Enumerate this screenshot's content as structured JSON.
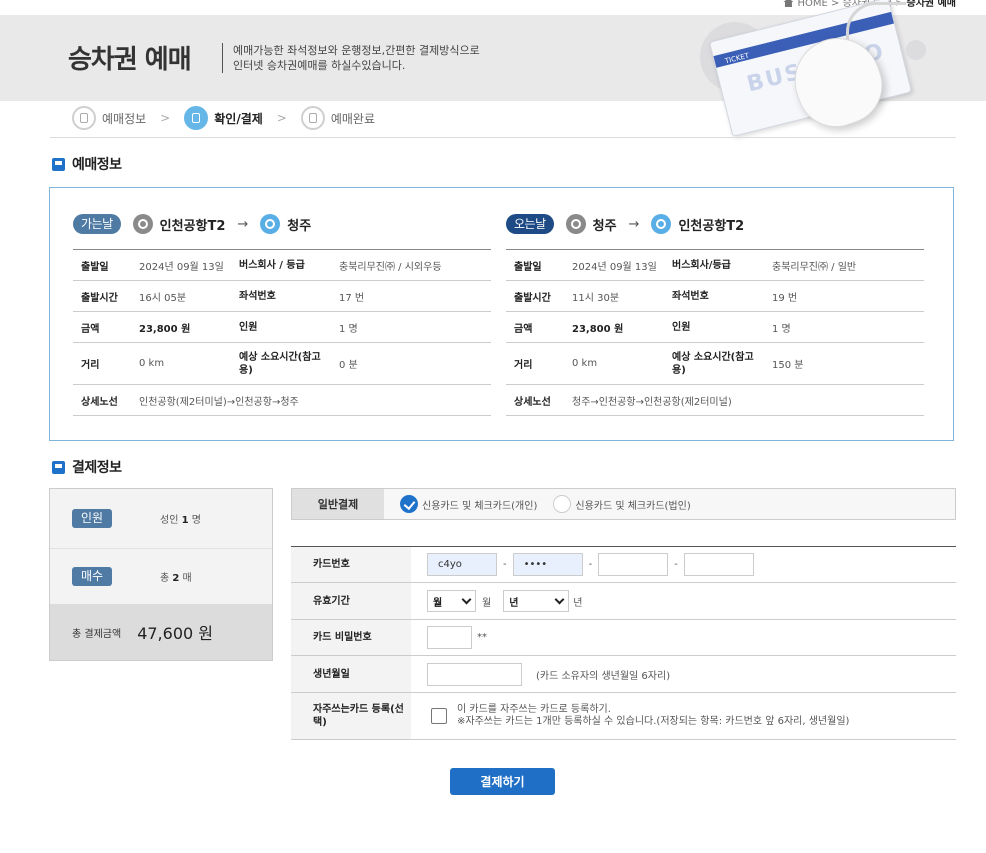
{
  "breadcrumb": {
    "home": "HOME",
    "sep": ">",
    "parent": "승차권 예매",
    "current": "승차권 예매"
  },
  "hero": {
    "title": "승차권 예매",
    "desc_line1": "예매가능한 좌석정보와 운행정보,간편한 결제방식으로",
    "desc_line2": "인터넷 승차권예매를 하실수있습니다.",
    "card_stripe": "TICKET",
    "card_logo": "BUS TAGO"
  },
  "steps": [
    {
      "label": "예매정보",
      "active": false
    },
    {
      "label": "확인/결제",
      "active": true
    },
    {
      "label": "예매완료",
      "active": false
    }
  ],
  "step_arrow": ">",
  "reservation": {
    "title": "예매정보",
    "outbound": {
      "badge": "가는날",
      "from": "인천공항T2",
      "to": "청주",
      "arrow": "→",
      "labels": {
        "date": "출발일",
        "company": "버스회사 / 등급",
        "time": "출발시간",
        "seat": "좌석번호",
        "price": "금액",
        "people": "인원",
        "distance": "거리",
        "duration": "예상 소요시간(참고용)",
        "route": "상세노선"
      },
      "date": "2024년 09월 13일",
      "company": "충북리무진㈜ / 시외우등",
      "time": "16시 05분",
      "seat": "17 번",
      "price": "23,800 원",
      "people": "1 명",
      "distance": "0 km",
      "duration": "0 분",
      "route": "인천공항(제2터미널)→인천공항→청주"
    },
    "return": {
      "badge": "오는날",
      "from": "청주",
      "to": "인천공항T2",
      "arrow": "→",
      "labels": {
        "date": "출발일",
        "company": "버스회사/등급",
        "time": "출발시간",
        "seat": "좌석번호",
        "price": "금액",
        "people": "인원",
        "distance": "거리",
        "duration": "예상 소요시간(참고용)",
        "route": "상세노선"
      },
      "date": "2024년 09월 13일",
      "company": "충북리무진㈜ / 일반",
      "time": "11시 30분",
      "seat": "19 번",
      "price": "23,800 원",
      "people": "1 명",
      "distance": "0 km",
      "duration": "150 분",
      "route": "청주→인천공항→인천공항(제2터미널)"
    }
  },
  "payment": {
    "title": "결제정보",
    "summary": {
      "people_badge": "인원",
      "people_value_pre": "성인",
      "people_value_num": "1",
      "people_value_post": "명",
      "count_badge": "매수",
      "count_value_pre": "총",
      "count_value_num": "2",
      "count_value_post": "매",
      "total_label": "총 결제금액",
      "total_value": "47,600 원"
    },
    "type_tab": "일반결제",
    "options": [
      {
        "label": "신용카드 및 체크카드(개인)",
        "selected": true
      },
      {
        "label": "신용카드 및 체크카드(법인)",
        "selected": false
      }
    ],
    "form": {
      "card_number_label": "카드번호",
      "card_parts": [
        "c4yo",
        "••••",
        "",
        ""
      ],
      "card_sep": "-",
      "expiry_label": "유효기간",
      "month_value": "월",
      "month_unit": "월",
      "year_value": "년",
      "year_unit": "년",
      "pin_label": "카드 비밀번호",
      "pin_suffix": "**",
      "birth_label": "생년월일",
      "birth_hint": "(카드 소유자의 생년월일 6자리)",
      "fav_label": "자주쓰는카드 등록(선택)",
      "fav_line1": "이 카드를 자주쓰는 카드로 등록하기.",
      "fav_line2": "※자주쓰는 카드는 1개만 등록하실 수 있습니다.(저장되는 항목: 카드번호 앞 6자리, 생년월일)"
    },
    "submit": "결제하기"
  }
}
